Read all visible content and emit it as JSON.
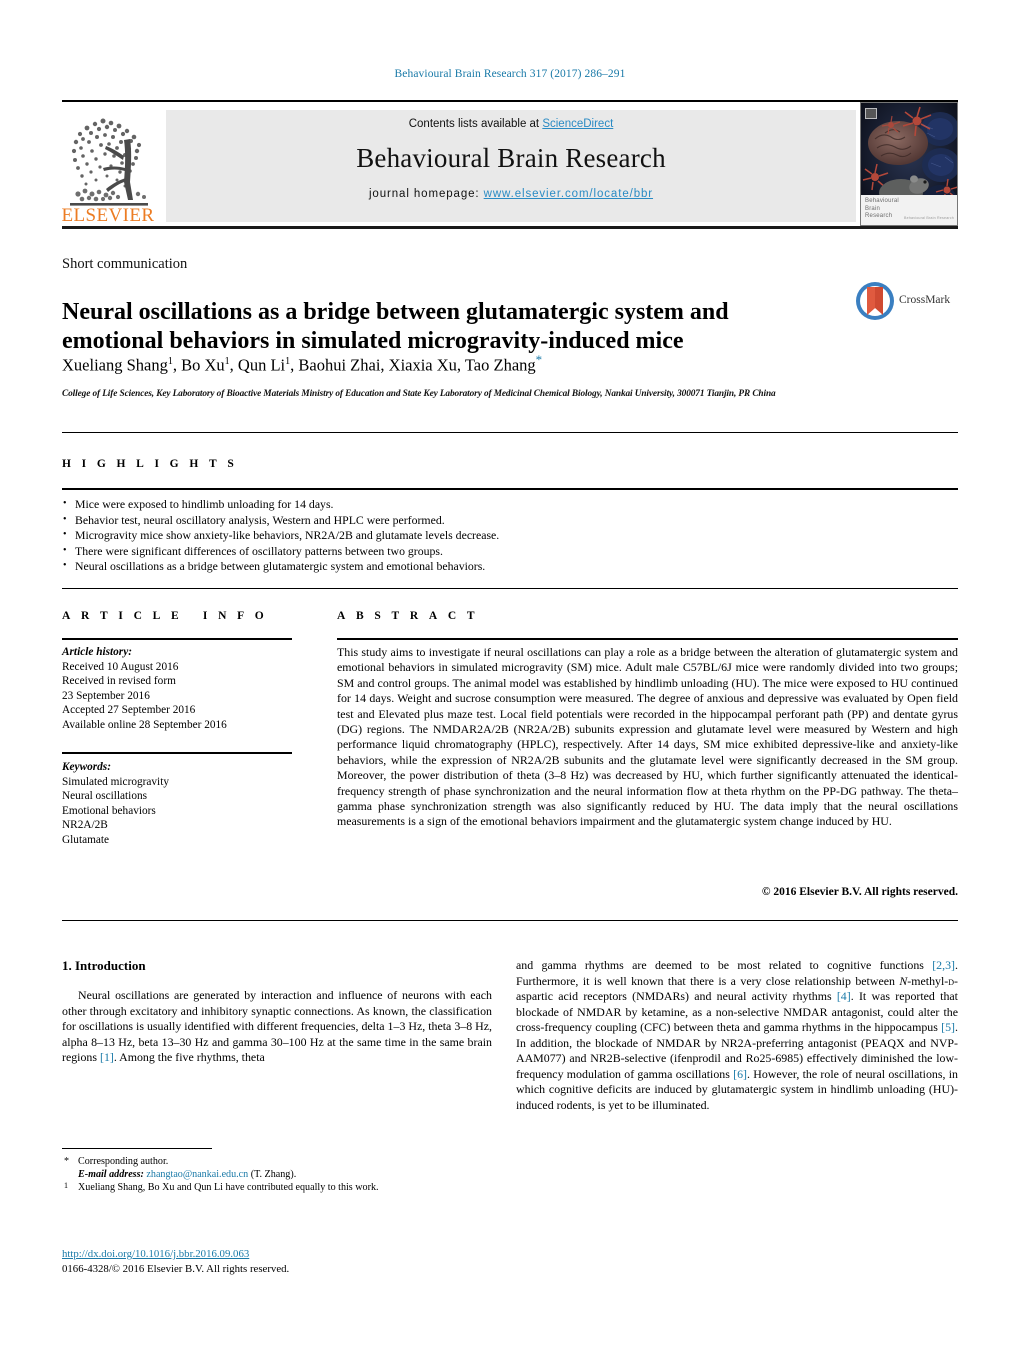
{
  "running_head": "Behavioural Brain Research 317 (2017) 286–291",
  "masthead": {
    "contents_prefix": "Contents lists available at ",
    "sciencedirect": "ScienceDirect",
    "journal_title": "Behavioural Brain Research",
    "homepage_label": "journal homepage:",
    "homepage_url": "www.elsevier.com/locate/bbr",
    "publisher_logo_text": "ELSEVIER",
    "cover_caption_line1": "Behavioural",
    "cover_caption_line2": "Brain",
    "cover_caption_line3": "Research",
    "cover_caption_small": "Behavioural Brain Research"
  },
  "colors": {
    "link": "#1a7aa8",
    "sciencedirect": "#2a8bc4",
    "elsevier_orange": "#ec7c23",
    "band_grey": "#e9e9e9"
  },
  "article": {
    "type": "Short communication",
    "title": "Neural oscillations as a bridge between glutamatergic system and emotional behaviors in simulated microgravity-induced mice",
    "crossmark_label": "CrossMark",
    "authors_html": "Xueliang Shang<sup>1</sup>, Bo Xu<sup>1</sup>, Qun Li<sup>1</sup>, Baohui Zhai, Xiaxia Xu, Tao Zhang<span class=\"star\">*</span>",
    "affiliation": "College of Life Sciences, Key Laboratory of Bioactive Materials Ministry of Education and State Key Laboratory of Medicinal Chemical Biology, Nankai University, 300071 Tianjin, PR China"
  },
  "highlights": {
    "heading": "HIGHLIGHTS",
    "items": [
      "Mice were exposed to hindlimb unloading for 14 days.",
      "Behavior test, neural oscillatory analysis, Western and HPLC were performed.",
      "Microgravity mice show anxiety-like behaviors, NR2A/2B and glutamate levels decrease.",
      "There were significant differences of oscillatory patterns between two groups.",
      "Neural oscillations as a bridge between glutamatergic system and emotional behaviors."
    ]
  },
  "article_info": {
    "heading": "ARTICLE INFO",
    "history_label": "Article history:",
    "history_lines": [
      "Received 10 August 2016",
      "Received in revised form",
      "23 September 2016",
      "Accepted 27 September 2016",
      "Available online 28 September 2016"
    ],
    "keywords_label": "Keywords:",
    "keywords": [
      "Simulated microgravity",
      "Neural oscillations",
      "Emotional behaviors",
      "NR2A/2B",
      "Glutamate"
    ]
  },
  "abstract": {
    "heading": "ABSTRACT",
    "text": "This study aims to investigate if neural oscillations can play a role as a bridge between the alteration of glutamatergic system and emotional behaviors in simulated microgravity (SM) mice. Adult male C57BL/6J mice were randomly divided into two groups; SM and control groups. The animal model was established by hindlimb unloading (HU). The mice were exposed to HU continued for 14 days. Weight and sucrose consumption were measured. The degree of anxious and depressive was evaluated by Open field test and Elevated plus maze test. Local field potentials were recorded in the hippocampal perforant path (PP) and dentate gyrus (DG) regions. The NMDAR2A/2B (NR2A/2B) subunits expression and glutamate level were measured by Western and high performance liquid chromatography (HPLC), respectively. After 14 days, SM mice exhibited depressive-like and anxiety-like behaviors, while the expression of NR2A/2B subunits and the glutamate level were significantly decreased in the SM group. Moreover, the power distribution of theta (3–8 Hz) was decreased by HU, which further significantly attenuated the identical-frequency strength of phase synchronization and the neural information flow at theta rhythm on the PP-DG pathway. The theta–gamma phase synchronization strength was also significantly reduced by HU. The data imply that the neural oscillations measurements is a sign of the emotional behaviors impairment and the glutamatergic system change induced by HU.",
    "copyright": "© 2016 Elsevier B.V. All rights reserved."
  },
  "body": {
    "section_number_title": "1. Introduction",
    "left_column_html": "<p class=\"indent\">Neural oscillations are generated by interaction and influence of neurons with each other through excitatory and inhibitory synaptic connections. As known, the classification for oscillations is usually identified with different frequencies, delta 1–3 Hz, theta 3–8 Hz, alpha 8–13 Hz, beta 13–30 Hz and gamma 30–100 Hz at the same time in the same brain regions <span class=\"ref\">[1]</span>. Among the five rhythms, theta</p>",
    "right_column_html": "<p>and gamma rhythms are deemed to be most related to cognitive functions <span class=\"ref\">[2,3]</span>. Furthermore, it is well known that there is a very close relationship between <i>N</i>-methyl-<span style=\"font-variant:small-caps\">d</span>-aspartic acid receptors (NMDARs) and neural activity rhythms <span class=\"ref\">[4]</span>. It was reported that blockade of NMDAR by ketamine, as a non-selective NMDAR antagonist, could alter the cross-frequency coupling (CFC) between theta and gamma rhythms in the hippocampus <span class=\"ref\">[5]</span>. In addition, the blockade of NMDAR by NR2A-preferring antagonist (PEAQX and NVP-AAM077) and NR2B-selective (ifenprodil and Ro25-6985) effectively diminished the low-frequency modulation of gamma oscillations <span class=\"ref\">[6]</span>. However, the role of neural oscillations, in which cognitive deficits are induced by glutamatergic system in hindlimb unloading (HU)-induced rodents, is yet to be illuminated.</p>"
  },
  "footnotes": {
    "corresponding_marker": "*",
    "corresponding_text": "Corresponding author.",
    "email_label": "E-mail address:",
    "email": "zhangtao@nankai.edu.cn",
    "email_suffix": "(T. Zhang).",
    "equal_marker": "1",
    "equal_text": "Xueliang Shang, Bo Xu and Qun Li have contributed equally to this work."
  },
  "footer": {
    "doi": "http://dx.doi.org/10.1016/j.bbr.2016.09.063",
    "issn_line": "0166-4328/© 2016 Elsevier B.V. All rights reserved."
  }
}
